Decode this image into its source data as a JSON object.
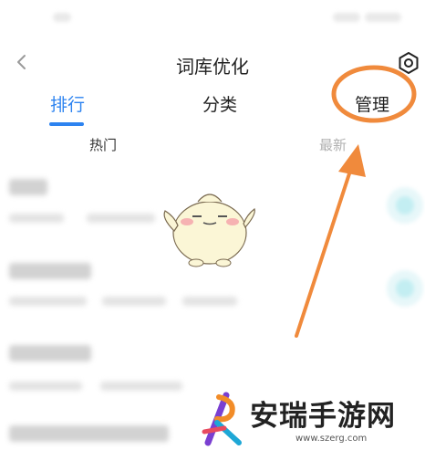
{
  "header": {
    "title": "词库优化",
    "back_icon": "chevron-left-icon",
    "settings_icon": "gear-icon"
  },
  "tabs": [
    {
      "label": "排行",
      "active": true
    },
    {
      "label": "分类",
      "active": false
    },
    {
      "label": "管理",
      "active": false
    }
  ],
  "subtabs": [
    {
      "label": "热门",
      "active": true
    },
    {
      "label": "最新",
      "active": false
    }
  ],
  "colors": {
    "accent": "#2d83f0",
    "annotation": "#f08a3c",
    "add_button": "#c3eef2"
  },
  "watermark": {
    "name": "安瑞手游网",
    "url": "www.szerg.com"
  }
}
